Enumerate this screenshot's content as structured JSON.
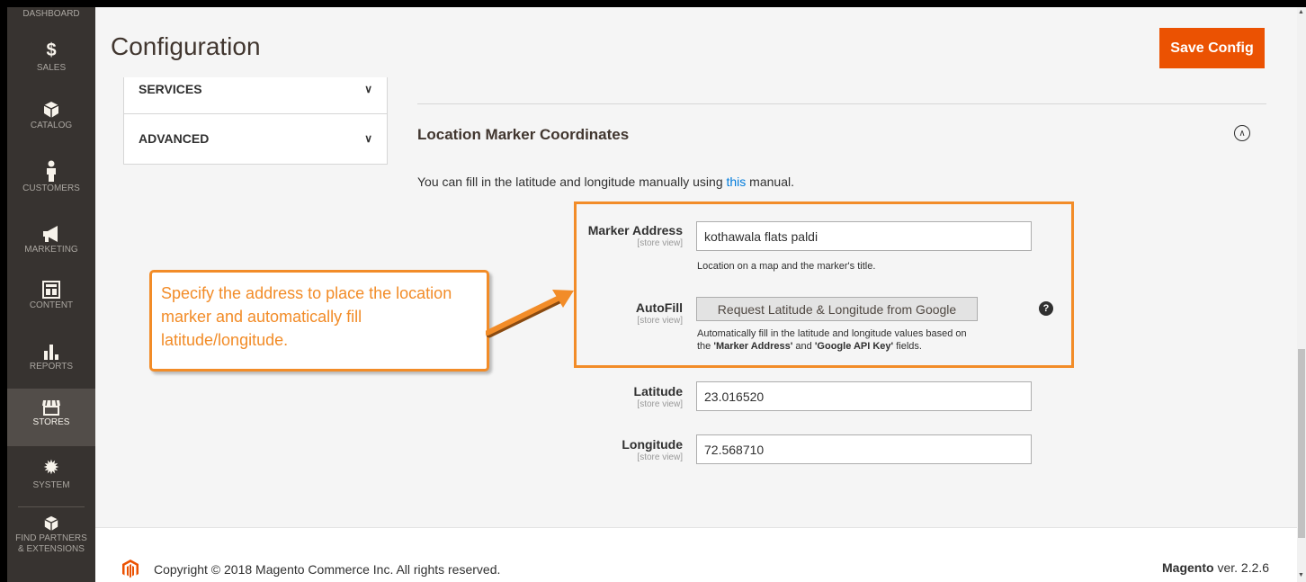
{
  "sidebar": {
    "items": [
      {
        "label": "DASHBOARD",
        "icon": "dashboard-icon"
      },
      {
        "label": "SALES",
        "icon": "dollar-icon"
      },
      {
        "label": "CATALOG",
        "icon": "box-icon"
      },
      {
        "label": "CUSTOMERS",
        "icon": "person-icon"
      },
      {
        "label": "MARKETING",
        "icon": "megaphone-icon"
      },
      {
        "label": "CONTENT",
        "icon": "layout-icon"
      },
      {
        "label": "REPORTS",
        "icon": "bar-chart-icon"
      },
      {
        "label": "STORES",
        "icon": "store-icon"
      },
      {
        "label": "SYSTEM",
        "icon": "gear-icon"
      },
      {
        "label": "FIND PARTNERS",
        "label2": "& EXTENSIONS",
        "icon": "partners-icon"
      }
    ]
  },
  "header": {
    "title": "Configuration",
    "save_label": "Save Config"
  },
  "tabs": [
    {
      "label": "SERVICES"
    },
    {
      "label": "ADVANCED"
    }
  ],
  "section": {
    "title": "Location Marker Coordinates",
    "intro_before": "You can fill in the latitude and longitude manually using ",
    "intro_link": "this",
    "intro_after": " manual."
  },
  "fields": {
    "scope": "[store view]",
    "marker_address": {
      "label": "Marker Address",
      "value": "kothawala flats paldi",
      "note": "Location on a map and the marker's title."
    },
    "autofill": {
      "label": "AutoFill",
      "button": "Request Latitude & Longitude from Google",
      "note_line1": "Automatically fill in the latitude and longitude values based on",
      "note_the": "the ",
      "note_b1": "'Marker Address'",
      "note_and": " and ",
      "note_b2": "'Google API Key'",
      "note_end": " fields."
    },
    "latitude": {
      "label": "Latitude",
      "value": "23.016520"
    },
    "longitude": {
      "label": "Longitude",
      "value": "72.568710"
    }
  },
  "callout": {
    "text": "Specify the address to place the location marker and automatically fill latitude/longitude."
  },
  "footer": {
    "copyright": "Copyright © 2018 Magento Commerce Inc. All rights reserved.",
    "brand": "Magento",
    "version": " ver. 2.2.6"
  },
  "colors": {
    "accent": "#eb5202",
    "sidebar": "#373330",
    "callout": "#f28c28",
    "link": "#007bdb"
  }
}
